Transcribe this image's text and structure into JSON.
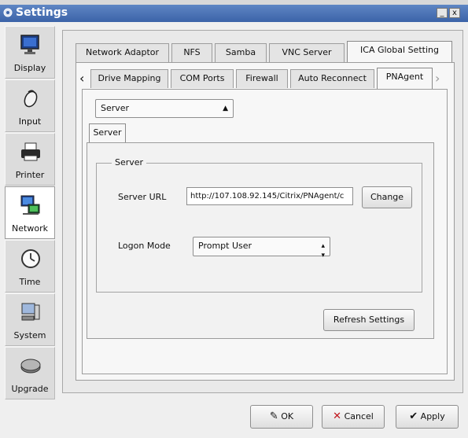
{
  "window": {
    "title": "Settings",
    "minimize": "_",
    "close": "x"
  },
  "sidebar": {
    "items": [
      {
        "label": "Display",
        "icon": "display-icon"
      },
      {
        "label": "Input",
        "icon": "mouse-icon"
      },
      {
        "label": "Printer",
        "icon": "printer-icon"
      },
      {
        "label": "Network",
        "icon": "network-icon",
        "selected": true
      },
      {
        "label": "Time",
        "icon": "clock-icon"
      },
      {
        "label": "System",
        "icon": "system-icon"
      },
      {
        "label": "Upgrade",
        "icon": "chip-icon"
      }
    ]
  },
  "tabs_primary": [
    "Network Adaptor",
    "NFS",
    "Samba",
    "VNC Server",
    "ICA Global Setting"
  ],
  "tabs_secondary": {
    "scroll_left": "‹",
    "scroll_right": "›",
    "items": [
      "Drive Mapping",
      "COM Ports",
      "Firewall",
      "Auto Reconnect",
      "PNAgent"
    ]
  },
  "mode_select": {
    "value": "Server"
  },
  "inner_tab": "Server",
  "server_group": {
    "title": "Server",
    "server_url_label": "Server URL",
    "server_url_value": "http://107.108.92.145/Citrix/PNAgent/c",
    "change_button": "Change",
    "logon_mode_label": "Logon Mode",
    "logon_mode_value": "Prompt User"
  },
  "refresh_button": "Refresh Settings",
  "footer": {
    "ok": "OK",
    "cancel": "Cancel",
    "apply": "Apply"
  },
  "colors": {
    "titlebar": "#4a73b5",
    "ok_icon": "#2a2a2a",
    "cancel_icon": "#c0141b",
    "apply_icon": "#1a1a1a"
  }
}
